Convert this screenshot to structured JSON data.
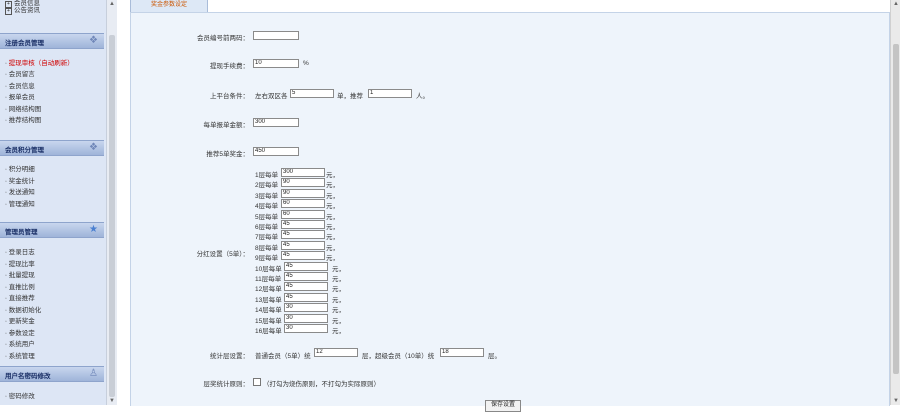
{
  "sidebar": {
    "tree_items": [
      "会员信息",
      "公告资讯"
    ],
    "sections": [
      {
        "title": "注册会员管理",
        "icon": "members-icon",
        "items": [
          {
            "label": "提现审核（自动刷新）",
            "active": true
          },
          {
            "label": "会员留言",
            "active": false
          },
          {
            "label": "会员信息",
            "active": false
          },
          {
            "label": "报单会员",
            "active": false
          },
          {
            "label": "网络结构图",
            "active": false
          },
          {
            "label": "推荐结构图",
            "active": false
          }
        ]
      },
      {
        "title": "会员积分管理",
        "icon": "points-icon",
        "items": [
          {
            "label": "积分明细",
            "active": false
          },
          {
            "label": "奖金统计",
            "active": false
          },
          {
            "label": "发送通知",
            "active": false
          },
          {
            "label": "管理通知",
            "active": false
          }
        ]
      },
      {
        "title": "管理员管理",
        "icon": "admin-icon",
        "items": [
          {
            "label": "登录日志",
            "active": false
          },
          {
            "label": "提现比率",
            "active": false
          },
          {
            "label": "批量提现",
            "active": false
          },
          {
            "label": "直推比例",
            "active": false
          },
          {
            "label": "直接推荐",
            "active": false
          },
          {
            "label": "数据初始化",
            "active": false
          },
          {
            "label": "更新奖金",
            "active": false
          },
          {
            "label": "参数设定",
            "active": false
          },
          {
            "label": "系统用户",
            "active": false
          },
          {
            "label": "系统管理",
            "active": false
          }
        ]
      },
      {
        "title": "用户名密码修改",
        "icon": "user-key-icon",
        "items": [
          {
            "label": "密码修改",
            "active": false
          }
        ]
      }
    ]
  },
  "tab": {
    "label": "奖金参数设定"
  },
  "form": {
    "prefix": {
      "label": "会员编号前两码：",
      "value": ""
    },
    "fee": {
      "label": "提现手续费：",
      "value": "10",
      "unit": "%"
    },
    "upgrade": {
      "label": "上平台条件：",
      "text1": "左右双区各",
      "value1": "5",
      "text2": "单，推荐",
      "value2": "1",
      "text3": "人。"
    },
    "per_order": {
      "label": "每单报单金额：",
      "value": "300"
    },
    "refer_bonus": {
      "label": "推荐5单奖金：",
      "value": "450"
    },
    "dividend": {
      "label": "分红设置（5单）：",
      "levels": [
        {
          "name": "1层每单",
          "value": "300",
          "unit": "元，"
        },
        {
          "name": "2层每单",
          "value": "90",
          "unit": "元，"
        },
        {
          "name": "3层每单",
          "value": "90",
          "unit": "元，"
        },
        {
          "name": "4层每单",
          "value": "60",
          "unit": "元，"
        },
        {
          "name": "5层每单",
          "value": "60",
          "unit": "元，"
        },
        {
          "name": "6层每单",
          "value": "45",
          "unit": "元，"
        },
        {
          "name": "7层每单",
          "value": "45",
          "unit": "元，"
        },
        {
          "name": "8层每单",
          "value": "45",
          "unit": "元，"
        },
        {
          "name": "9层每单",
          "value": "45",
          "unit": "元，"
        },
        {
          "name": "10层每单",
          "value": "45",
          "unit": "元，"
        },
        {
          "name": "11层每单",
          "value": "45",
          "unit": "元，"
        },
        {
          "name": "12层每单",
          "value": "45",
          "unit": "元，"
        },
        {
          "name": "13层每单",
          "value": "45",
          "unit": "元，"
        },
        {
          "name": "14层每单",
          "value": "30",
          "unit": "元，"
        },
        {
          "name": "15层每单",
          "value": "30",
          "unit": "元，"
        },
        {
          "name": "16层每单",
          "value": "30",
          "unit": "元，"
        }
      ]
    },
    "layers": {
      "label": "统计层设置：",
      "text1": "普通会员（5单）统",
      "value1": "12",
      "text2": "层，超级会员（10单）统",
      "value2": "18",
      "text3": "层。"
    },
    "rule": {
      "label": "层奖统计原则：",
      "text": "（打勾为烧伤原则，不打勾为实际原则）"
    },
    "submit_label": "保存设置"
  }
}
